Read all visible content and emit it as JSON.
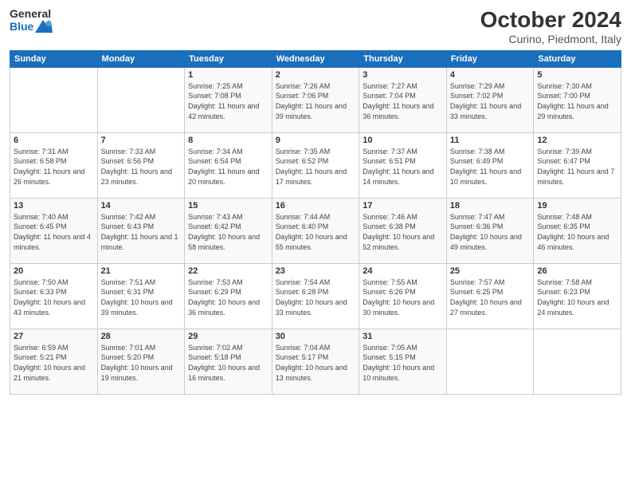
{
  "logo": {
    "line1": "General",
    "line2": "Blue"
  },
  "title": "October 2024",
  "subtitle": "Curino, Piedmont, Italy",
  "header": {
    "days": [
      "Sunday",
      "Monday",
      "Tuesday",
      "Wednesday",
      "Thursday",
      "Friday",
      "Saturday"
    ]
  },
  "weeks": [
    [
      {
        "day": "",
        "sunrise": "",
        "sunset": "",
        "daylight": ""
      },
      {
        "day": "",
        "sunrise": "",
        "sunset": "",
        "daylight": ""
      },
      {
        "day": "1",
        "sunrise": "Sunrise: 7:25 AM",
        "sunset": "Sunset: 7:08 PM",
        "daylight": "Daylight: 11 hours and 42 minutes."
      },
      {
        "day": "2",
        "sunrise": "Sunrise: 7:26 AM",
        "sunset": "Sunset: 7:06 PM",
        "daylight": "Daylight: 11 hours and 39 minutes."
      },
      {
        "day": "3",
        "sunrise": "Sunrise: 7:27 AM",
        "sunset": "Sunset: 7:04 PM",
        "daylight": "Daylight: 11 hours and 36 minutes."
      },
      {
        "day": "4",
        "sunrise": "Sunrise: 7:29 AM",
        "sunset": "Sunset: 7:02 PM",
        "daylight": "Daylight: 11 hours and 33 minutes."
      },
      {
        "day": "5",
        "sunrise": "Sunrise: 7:30 AM",
        "sunset": "Sunset: 7:00 PM",
        "daylight": "Daylight: 11 hours and 29 minutes."
      }
    ],
    [
      {
        "day": "6",
        "sunrise": "Sunrise: 7:31 AM",
        "sunset": "Sunset: 6:58 PM",
        "daylight": "Daylight: 11 hours and 26 minutes."
      },
      {
        "day": "7",
        "sunrise": "Sunrise: 7:33 AM",
        "sunset": "Sunset: 6:56 PM",
        "daylight": "Daylight: 11 hours and 23 minutes."
      },
      {
        "day": "8",
        "sunrise": "Sunrise: 7:34 AM",
        "sunset": "Sunset: 6:54 PM",
        "daylight": "Daylight: 11 hours and 20 minutes."
      },
      {
        "day": "9",
        "sunrise": "Sunrise: 7:35 AM",
        "sunset": "Sunset: 6:52 PM",
        "daylight": "Daylight: 11 hours and 17 minutes."
      },
      {
        "day": "10",
        "sunrise": "Sunrise: 7:37 AM",
        "sunset": "Sunset: 6:51 PM",
        "daylight": "Daylight: 11 hours and 14 minutes."
      },
      {
        "day": "11",
        "sunrise": "Sunrise: 7:38 AM",
        "sunset": "Sunset: 6:49 PM",
        "daylight": "Daylight: 11 hours and 10 minutes."
      },
      {
        "day": "12",
        "sunrise": "Sunrise: 7:39 AM",
        "sunset": "Sunset: 6:47 PM",
        "daylight": "Daylight: 11 hours and 7 minutes."
      }
    ],
    [
      {
        "day": "13",
        "sunrise": "Sunrise: 7:40 AM",
        "sunset": "Sunset: 6:45 PM",
        "daylight": "Daylight: 11 hours and 4 minutes."
      },
      {
        "day": "14",
        "sunrise": "Sunrise: 7:42 AM",
        "sunset": "Sunset: 6:43 PM",
        "daylight": "Daylight: 11 hours and 1 minute."
      },
      {
        "day": "15",
        "sunrise": "Sunrise: 7:43 AM",
        "sunset": "Sunset: 6:42 PM",
        "daylight": "Daylight: 10 hours and 58 minutes."
      },
      {
        "day": "16",
        "sunrise": "Sunrise: 7:44 AM",
        "sunset": "Sunset: 6:40 PM",
        "daylight": "Daylight: 10 hours and 55 minutes."
      },
      {
        "day": "17",
        "sunrise": "Sunrise: 7:46 AM",
        "sunset": "Sunset: 6:38 PM",
        "daylight": "Daylight: 10 hours and 52 minutes."
      },
      {
        "day": "18",
        "sunrise": "Sunrise: 7:47 AM",
        "sunset": "Sunset: 6:36 PM",
        "daylight": "Daylight: 10 hours and 49 minutes."
      },
      {
        "day": "19",
        "sunrise": "Sunrise: 7:48 AM",
        "sunset": "Sunset: 6:35 PM",
        "daylight": "Daylight: 10 hours and 46 minutes."
      }
    ],
    [
      {
        "day": "20",
        "sunrise": "Sunrise: 7:50 AM",
        "sunset": "Sunset: 6:33 PM",
        "daylight": "Daylight: 10 hours and 43 minutes."
      },
      {
        "day": "21",
        "sunrise": "Sunrise: 7:51 AM",
        "sunset": "Sunset: 6:31 PM",
        "daylight": "Daylight: 10 hours and 39 minutes."
      },
      {
        "day": "22",
        "sunrise": "Sunrise: 7:53 AM",
        "sunset": "Sunset: 6:29 PM",
        "daylight": "Daylight: 10 hours and 36 minutes."
      },
      {
        "day": "23",
        "sunrise": "Sunrise: 7:54 AM",
        "sunset": "Sunset: 6:28 PM",
        "daylight": "Daylight: 10 hours and 33 minutes."
      },
      {
        "day": "24",
        "sunrise": "Sunrise: 7:55 AM",
        "sunset": "Sunset: 6:26 PM",
        "daylight": "Daylight: 10 hours and 30 minutes."
      },
      {
        "day": "25",
        "sunrise": "Sunrise: 7:57 AM",
        "sunset": "Sunset: 6:25 PM",
        "daylight": "Daylight: 10 hours and 27 minutes."
      },
      {
        "day": "26",
        "sunrise": "Sunrise: 7:58 AM",
        "sunset": "Sunset: 6:23 PM",
        "daylight": "Daylight: 10 hours and 24 minutes."
      }
    ],
    [
      {
        "day": "27",
        "sunrise": "Sunrise: 6:59 AM",
        "sunset": "Sunset: 5:21 PM",
        "daylight": "Daylight: 10 hours and 21 minutes."
      },
      {
        "day": "28",
        "sunrise": "Sunrise: 7:01 AM",
        "sunset": "Sunset: 5:20 PM",
        "daylight": "Daylight: 10 hours and 19 minutes."
      },
      {
        "day": "29",
        "sunrise": "Sunrise: 7:02 AM",
        "sunset": "Sunset: 5:18 PM",
        "daylight": "Daylight: 10 hours and 16 minutes."
      },
      {
        "day": "30",
        "sunrise": "Sunrise: 7:04 AM",
        "sunset": "Sunset: 5:17 PM",
        "daylight": "Daylight: 10 hours and 13 minutes."
      },
      {
        "day": "31",
        "sunrise": "Sunrise: 7:05 AM",
        "sunset": "Sunset: 5:15 PM",
        "daylight": "Daylight: 10 hours and 10 minutes."
      },
      {
        "day": "",
        "sunrise": "",
        "sunset": "",
        "daylight": ""
      },
      {
        "day": "",
        "sunrise": "",
        "sunset": "",
        "daylight": ""
      }
    ]
  ]
}
